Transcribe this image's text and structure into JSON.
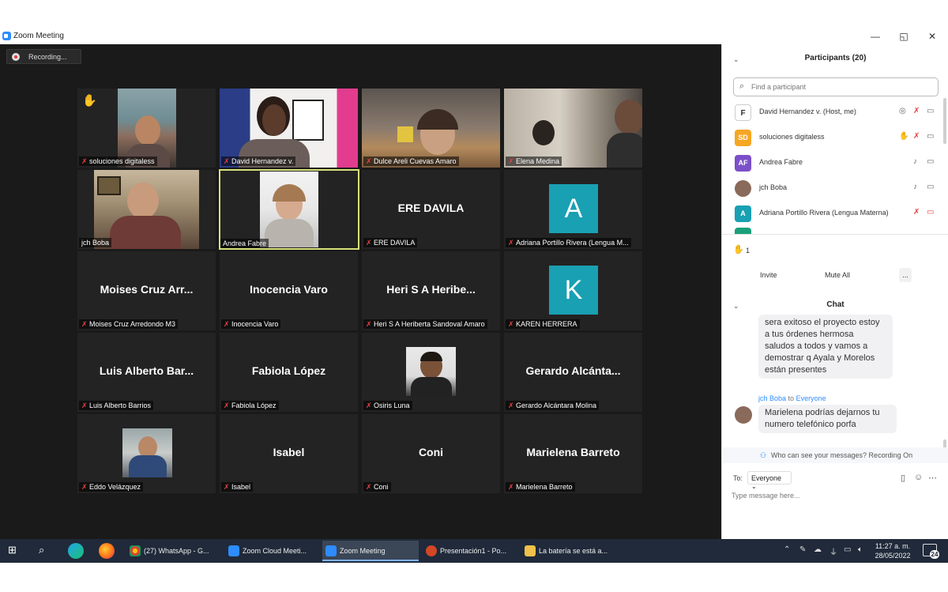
{
  "window": {
    "title": "Zoom Meeting",
    "minimize": "—",
    "maximize": "◱",
    "close": "✕"
  },
  "recording": {
    "label": "Recording..."
  },
  "tiles": [
    {
      "name": "soluciones digitaless",
      "big": "",
      "hand": "✋"
    },
    {
      "name": "David Hernandez v.",
      "big": ""
    },
    {
      "name": "Dulce Areli Cuevas Amaro",
      "big": ""
    },
    {
      "name": "Elena Medina",
      "big": ""
    },
    {
      "name": "jch Boba",
      "big": ""
    },
    {
      "name": "Andrea Fabre",
      "big": ""
    },
    {
      "name": "ERE DAVILA",
      "big": "ERE DAVILA"
    },
    {
      "name": "Adriana Portillo Rivera (Lengua M...",
      "big": "",
      "letter": "A"
    },
    {
      "name": "Moises Cruz Arredondo M3",
      "big": "Moises Cruz Arr..."
    },
    {
      "name": "Inocencia Varo",
      "big": "Inocencia Varo"
    },
    {
      "name": "Heri S A Heriberta Sandoval Amaro",
      "big": "Heri S A Heribe..."
    },
    {
      "name": "KAREN HERRERA",
      "big": "",
      "letter": "K"
    },
    {
      "name": "Luis Alberto Barrios",
      "big": "Luis Alberto Bar..."
    },
    {
      "name": "Fabiola López",
      "big": "Fabiola López"
    },
    {
      "name": "Osiris Luna",
      "big": ""
    },
    {
      "name": "Gerardo Alcántara Molina",
      "big": "Gerardo  Alcánta..."
    },
    {
      "name": "Eddo Velázquez",
      "big": ""
    },
    {
      "name": "Isabel",
      "big": "Isabel"
    },
    {
      "name": "Coni",
      "big": "Coni"
    },
    {
      "name": "Marielena Barreto",
      "big": "Marielena Barreto"
    }
  ],
  "participants": {
    "header": "Participants (20)",
    "search_placeholder": "Find a participant",
    "list": [
      {
        "initials": "",
        "name": "David Hernandez v. (Host, me)",
        "color": "#ffffff"
      },
      {
        "initials": "SD",
        "name": "soluciones digitaless",
        "color": "#f5a623"
      },
      {
        "initials": "AF",
        "name": "Andrea Fabre",
        "color": "#7b4fc9"
      },
      {
        "initials": "",
        "name": "jch Boba",
        "color": "#8a6a5a"
      },
      {
        "initials": "A",
        "name": "Adriana Portillo Rivera (Lengua Materna)",
        "color": "#19a0b3"
      }
    ],
    "raised_hands_count": "1",
    "invite": "Invite",
    "mute_all": "Mute All",
    "more": "..."
  },
  "chat": {
    "header": "Chat",
    "message1": [
      "sera exitoso el proyecto estoy",
      "a tus órdenes hermosa",
      "saludos a todos y vamos a",
      "demostrar q Ayala y Morelos",
      "están presentes"
    ],
    "sender2": "jch Boba",
    "to_word": "to",
    "recipient2": "Everyone",
    "message2": [
      "Marielena podrías dejarnos tu",
      "numero telefónico porfa"
    ],
    "who_can_see": "Who can see your messages? Recording On",
    "to_label": "To:",
    "to_value": "Everyone",
    "input_placeholder": "Type message here..."
  },
  "taskbar": {
    "apps": [
      {
        "label": "(27) WhatsApp - G...",
        "color": "#e8a33b"
      },
      {
        "label": "Zoom Cloud Meeti...",
        "color": "#2d8cff"
      },
      {
        "label": "Zoom Meeting",
        "color": "#2d8cff"
      },
      {
        "label": "Presentación1 - Po...",
        "color": "#d24726"
      },
      {
        "label": "La batería se está a...",
        "color": "#f0c24b"
      }
    ],
    "time": "11:27 a. m.",
    "date": "28/05/2022",
    "notifications": "24"
  }
}
